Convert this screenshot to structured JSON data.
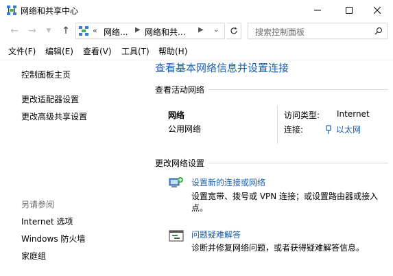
{
  "window": {
    "title": "网络和共享中心",
    "controls": {
      "minimize_icon": "minimize-icon",
      "maximize_icon": "maximize-icon",
      "close_icon": "close-icon"
    }
  },
  "address_bar": {
    "chevrons": "«",
    "segments": [
      "网络...",
      "网络和共..."
    ],
    "search_placeholder": "搜索控制面板"
  },
  "menu": [
    "文件(F)",
    "编辑(E)",
    "查看(V)",
    "工具(T)",
    "帮助(H)"
  ],
  "sidebar": {
    "links": [
      "控制面板主页",
      "更改适配器设置",
      "更改高级共享设置"
    ],
    "see_also_label": "另请参阅",
    "see_also": [
      "Internet 选项",
      "Windows 防火墙",
      "家庭组"
    ]
  },
  "main": {
    "title": "查看基本网络信息并设置连接",
    "active_networks_heading": "查看活动网络",
    "network": {
      "name": "网络",
      "category": "公用网络",
      "access_type_label": "访问类型:",
      "access_type_value": "Internet",
      "connections_label": "连接:",
      "connections_value": "以太网"
    },
    "change_settings_heading": "更改网络设置",
    "tasks": [
      {
        "link": "设置新的连接或网络",
        "desc_line1": "设置宽带、拨号或 VPN 连接；或设置路由器或接入",
        "desc_line2": "点。"
      },
      {
        "link": "问题疑难解答",
        "desc_line1": "诊断并修复网络问题，或者获得疑难解答信息。"
      }
    ]
  },
  "colors": {
    "link": "#1e5fa7",
    "title": "#1e5fa7",
    "muted": "#6d6d6d"
  }
}
